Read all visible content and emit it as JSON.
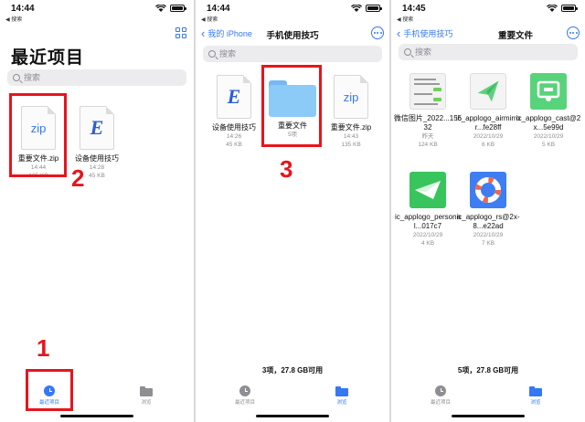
{
  "status": {
    "back_app": "◀ 搜索",
    "p1_time": "14:44",
    "p2_time": "14:44",
    "p3_time": "14:45"
  },
  "panel1": {
    "title": "最近项目",
    "search_placeholder": "搜索",
    "files": [
      {
        "name": "重要文件.zip",
        "time": "14:44",
        "size": "135 KB",
        "kind": "zip"
      },
      {
        "name": "设备使用技巧",
        "time": "14:28",
        "size": "45 KB",
        "kind": "doc"
      }
    ],
    "step_label": "2"
  },
  "panel2": {
    "back_label": "我的 iPhone",
    "title": "手机使用技巧",
    "search_placeholder": "搜索",
    "files": [
      {
        "name": "设备使用技巧",
        "time": "14:26",
        "size": "45 KB",
        "kind": "doc"
      },
      {
        "name": "重要文件",
        "count": "5项",
        "kind": "folder"
      },
      {
        "name": "重要文件.zip",
        "time": "14:43",
        "size": "135 KB",
        "kind": "zip"
      }
    ],
    "footer": "3项，27.8 GB可用",
    "step_label": "3"
  },
  "panel3": {
    "back_label": "手机使用技巧",
    "title": "重要文件",
    "search_placeholder": "搜索",
    "files": [
      {
        "name": "微信图片_2022...15532",
        "date": "昨天",
        "size": "124 KB"
      },
      {
        "name": "ic_applogo_airmirror...fe28ff",
        "date": "2022/10/29",
        "size": "6 KB"
      },
      {
        "name": "ic_applogo_cast@2x...5e99d",
        "date": "2022/10/29",
        "size": "5 KB"
      },
      {
        "name": "ic_applogo_personal...017c7",
        "date": "2022/10/29",
        "size": "4 KB"
      },
      {
        "name": "ic_applogo_rs@2x-8...e22ad",
        "date": "2022/10/29",
        "size": "7 KB"
      }
    ],
    "footer": "5项，27.8 GB可用"
  },
  "tabbar": {
    "recent_label": "最近项目",
    "browse_label": "浏览"
  },
  "step1_label": "1",
  "colors": {
    "accent": "#3478f6",
    "annotation": "#e8141c"
  }
}
